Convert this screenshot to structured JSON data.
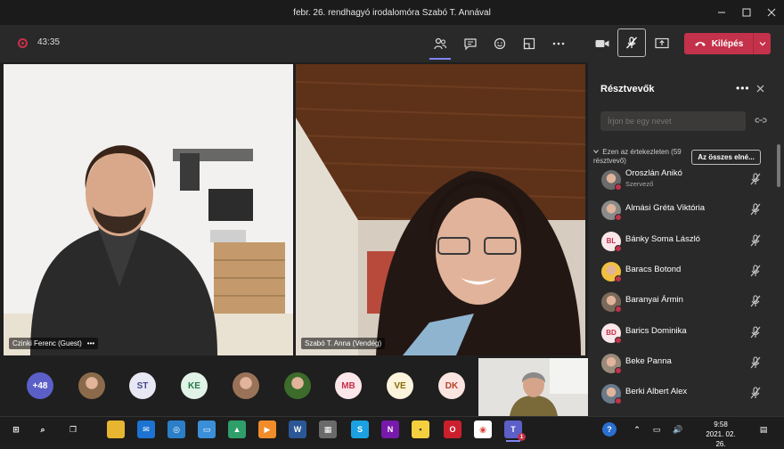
{
  "window": {
    "title": "febr. 26. rendhagyó irodalomóra Szabó T. Annával",
    "minimize_icon": "minimize-icon",
    "maximize_icon": "maximize-icon",
    "close_icon": "close-icon"
  },
  "toolbar": {
    "timer": "43:35",
    "recording_color": "#c4314b",
    "icons": [
      "participants-icon",
      "chat-icon",
      "reactions-icon",
      "rooms-icon",
      "more-actions-icon",
      "camera-icon",
      "mic-off-icon",
      "share-screen-icon"
    ],
    "leave_label": "Kilépés",
    "leave_color": "#c4314b"
  },
  "videos": [
    {
      "name": "Czinki Ferenc (Guest)"
    },
    {
      "name": "Szabó T. Anna (Vendég)"
    }
  ],
  "avatar_row": [
    {
      "label": "+48",
      "bg": "#5b5fc7",
      "fg": "#ffffff"
    },
    {
      "label": "",
      "bg": "#8a6a4a",
      "fg": "#ffffff",
      "photo": true
    },
    {
      "label": "ST",
      "bg": "#e8e8f4",
      "fg": "#444791"
    },
    {
      "label": "KE",
      "bg": "#e1f2e6",
      "fg": "#237b4b"
    },
    {
      "label": "",
      "bg": "#9a7258",
      "fg": "#ffffff",
      "photo": true
    },
    {
      "label": "",
      "bg": "#3d6b2c",
      "fg": "#ffffff",
      "photo": true
    },
    {
      "label": "MB",
      "bg": "#fbe7ea",
      "fg": "#c4314b"
    },
    {
      "label": "VE",
      "bg": "#fbf3dc",
      "fg": "#8a6b00"
    },
    {
      "label": "DK",
      "bg": "#fbe5e0",
      "fg": "#b4412d"
    }
  ],
  "panel": {
    "title": "Résztvevők",
    "more_icon": "more-options-icon",
    "close_icon": "close-icon",
    "search_placeholder": "Írjon be egy nevet",
    "share_icon": "copy-link-icon",
    "section_label": "Ezen az értekezleten (59 résztvevő)",
    "admit_all_label": "Az összes elné...",
    "participants": [
      {
        "name": "Oroszlán Anikó",
        "role": "Szervező",
        "initials": "",
        "bg": "#6b6b6b",
        "fg": "#ffffff",
        "photo": true
      },
      {
        "name": "Almási Gréta Viktória",
        "role": "",
        "initials": "",
        "bg": "#8a8a8a",
        "fg": "#ffffff",
        "photo": true
      },
      {
        "name": "Bánky Soma László",
        "role": "",
        "initials": "BL",
        "bg": "#fbe7ea",
        "fg": "#c4314b",
        "photo": false
      },
      {
        "name": "Baracs Botond",
        "role": "",
        "initials": "",
        "bg": "#f0c040",
        "fg": "#333333",
        "photo": true
      },
      {
        "name": "Baranyai Ármin",
        "role": "",
        "initials": "",
        "bg": "#7a6a5a",
        "fg": "#ffffff",
        "photo": true
      },
      {
        "name": "Barics Dominika",
        "role": "",
        "initials": "BD",
        "bg": "#fbe7ea",
        "fg": "#c4314b",
        "photo": false
      },
      {
        "name": "Beke Panna",
        "role": "",
        "initials": "",
        "bg": "#9a8a7a",
        "fg": "#ffffff",
        "photo": true
      },
      {
        "name": "Berki Albert Alex",
        "role": "",
        "initials": "",
        "bg": "#6a7a8a",
        "fg": "#ffffff",
        "photo": true
      }
    ]
  },
  "taskbar": {
    "apps": [
      "windows-start-icon",
      "search-icon",
      "task-view-icon",
      "file-explorer-icon",
      "mail-icon",
      "instagram-icon",
      "photos-icon",
      "maps-icon",
      "media-player-icon",
      "word-icon",
      "store-icon",
      "skype-icon",
      "onenote-icon",
      "sticky-notes-icon",
      "opera-icon",
      "chrome-icon",
      "teams-icon"
    ],
    "tray_icons": [
      "help-icon",
      "chevron-up-icon",
      "network-icon",
      "volume-icon",
      "notification-icon"
    ],
    "time": "9:58",
    "date": "2021. 02. 26.",
    "teams_badge": "1"
  }
}
